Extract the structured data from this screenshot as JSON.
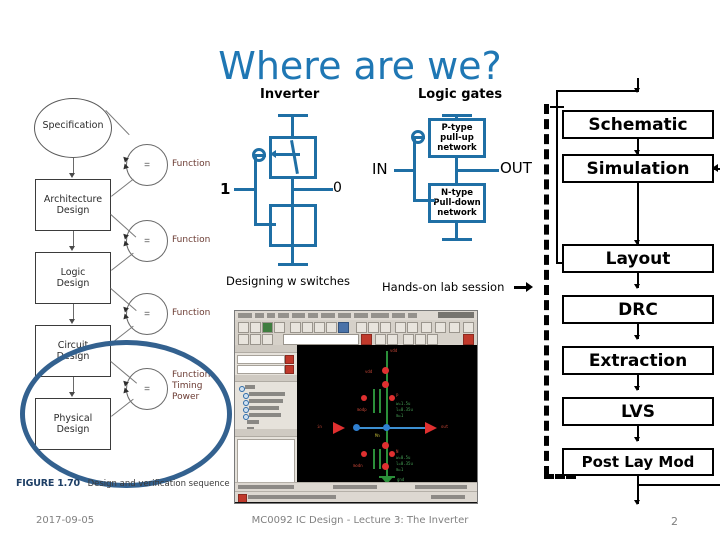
{
  "slide": {
    "title": "Where are we?",
    "title_color": "#1f77b4"
  },
  "left_figure": {
    "nodes": [
      {
        "label": "Specification",
        "shape": "ellipse"
      },
      {
        "label": "Architecture\nDesign",
        "shape": "box"
      },
      {
        "label": "Logic\nDesign",
        "shape": "box"
      },
      {
        "label": "Circuit\nDesign",
        "shape": "box"
      },
      {
        "label": "Physical\nDesign",
        "shape": "box"
      }
    ],
    "node_labels": {
      "specification": "Specification",
      "architecture_l1": "Architecture",
      "architecture_l2": "Design",
      "logic_l1": "Logic",
      "logic_l2": "Design",
      "circuit_l1": "Circuit",
      "circuit_l2": "Design",
      "physical_l1": "Physical",
      "physical_l2": "Design"
    },
    "equals_symbol": "=",
    "verify_labels": [
      {
        "lines": [
          "Function"
        ]
      },
      {
        "lines": [
          "Function"
        ]
      },
      {
        "lines": [
          "Function"
        ]
      },
      {
        "lines": [
          "Function",
          "Timing",
          "Power"
        ]
      }
    ],
    "verify_text": {
      "v1": "Function",
      "v2": "Function",
      "v3": "Function",
      "v4a": "Function",
      "v4b": "Timing",
      "v4c": "Power"
    },
    "caption_tag": "FIGURE 1.70",
    "caption_text": "Design and verification sequence",
    "annotation_color": "#33618f"
  },
  "inverter": {
    "heading": "Inverter",
    "input_label": "1",
    "output_label": "0",
    "caption": "Designing w switches",
    "wire_color": "#1f6fa5"
  },
  "logic_gates": {
    "heading": "Logic gates",
    "pullup_l1": "P-type",
    "pullup_l2": "pull-up",
    "pullup_l3": "network",
    "pulldown_l1": "N-type",
    "pulldown_l2": "Pull-down",
    "pulldown_l3": "network",
    "input_label": "IN",
    "output_label": "OUT",
    "caption": "Hands-on lab session",
    "wire_color": "#1f6fa5"
  },
  "flow": {
    "steps": [
      {
        "label": "Schematic"
      },
      {
        "label": "Simulation"
      },
      {
        "label": "Layout"
      },
      {
        "label": "DRC"
      },
      {
        "label": "Extraction"
      },
      {
        "label": "LVS"
      },
      {
        "label": "Post Lay Mod"
      }
    ],
    "step_labels": {
      "s0": "Schematic",
      "s1": "Simulation",
      "s2": "Layout",
      "s3": "DRC",
      "s4": "Extraction",
      "s5": "LVS",
      "s6": "Post Lay Mod"
    }
  },
  "eda_screenshot": {
    "net_vdd": "vdd",
    "net_gnd": "gnd",
    "pin_in": "in",
    "pin_out": "out",
    "dev_p": "P",
    "dev_n": "N"
  },
  "footer": {
    "date": "2017-09-05",
    "course": "MC0092 IC Design - Lecture 3: The Inverter",
    "page": "2"
  }
}
